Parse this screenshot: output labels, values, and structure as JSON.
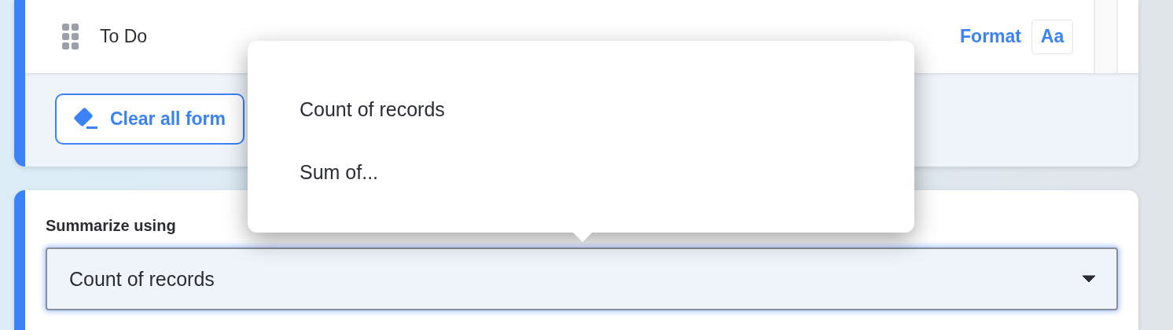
{
  "rows": [
    {
      "label": "To Do",
      "format_link": "Format",
      "format_button": "Aa"
    }
  ],
  "clear_button": "Clear all form",
  "summarize": {
    "label": "Summarize using",
    "value": "Count of records",
    "focused": true
  },
  "dropdown_menu": {
    "open": true,
    "items": [
      {
        "label": "Count of records",
        "selected": false
      },
      {
        "label": "Sum of...",
        "selected": false
      }
    ]
  }
}
